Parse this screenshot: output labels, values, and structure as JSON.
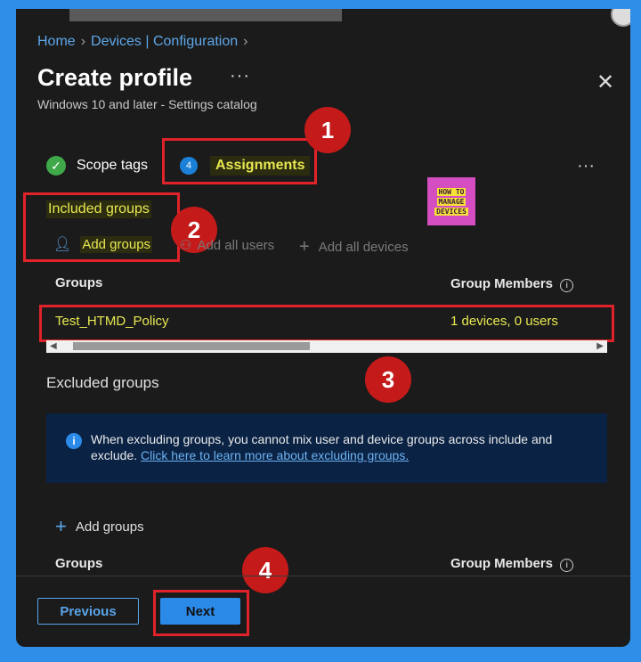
{
  "breadcrumb": {
    "home": "Home",
    "devices": "Devices | Configuration"
  },
  "page": {
    "title": "Create profile",
    "subtitle": "Windows 10 and later - Settings catalog",
    "more": "···"
  },
  "steps": {
    "scope": "Scope tags",
    "assignments": "Assignments",
    "assignments_number": "4"
  },
  "included": {
    "label": "Included groups",
    "add_groups": "Add groups",
    "add_all_users": "Add all users",
    "add_all_devices": "Add all devices",
    "col_groups": "Groups",
    "col_members": "Group Members",
    "rows": [
      {
        "group": "Test_HTMD_Policy",
        "members": "1 devices, 0 users"
      }
    ]
  },
  "excluded": {
    "label": "Excluded groups",
    "info_text": "When excluding groups, you cannot mix user and device groups across include and exclude.",
    "info_link": "Click here to learn more about excluding groups.",
    "add_groups": "Add groups",
    "col_groups": "Groups",
    "col_members": "Group Members"
  },
  "logo": {
    "line1": "HOW TO",
    "line2": "MANAGE",
    "line3": "DEVICES"
  },
  "annotations": [
    "1",
    "2",
    "3",
    "4"
  ],
  "footer": {
    "previous": "Previous",
    "next": "Next"
  },
  "colors": {
    "accent": "#2b8ae8",
    "highlight": "#e8e852",
    "annotation": "#e0232a"
  }
}
